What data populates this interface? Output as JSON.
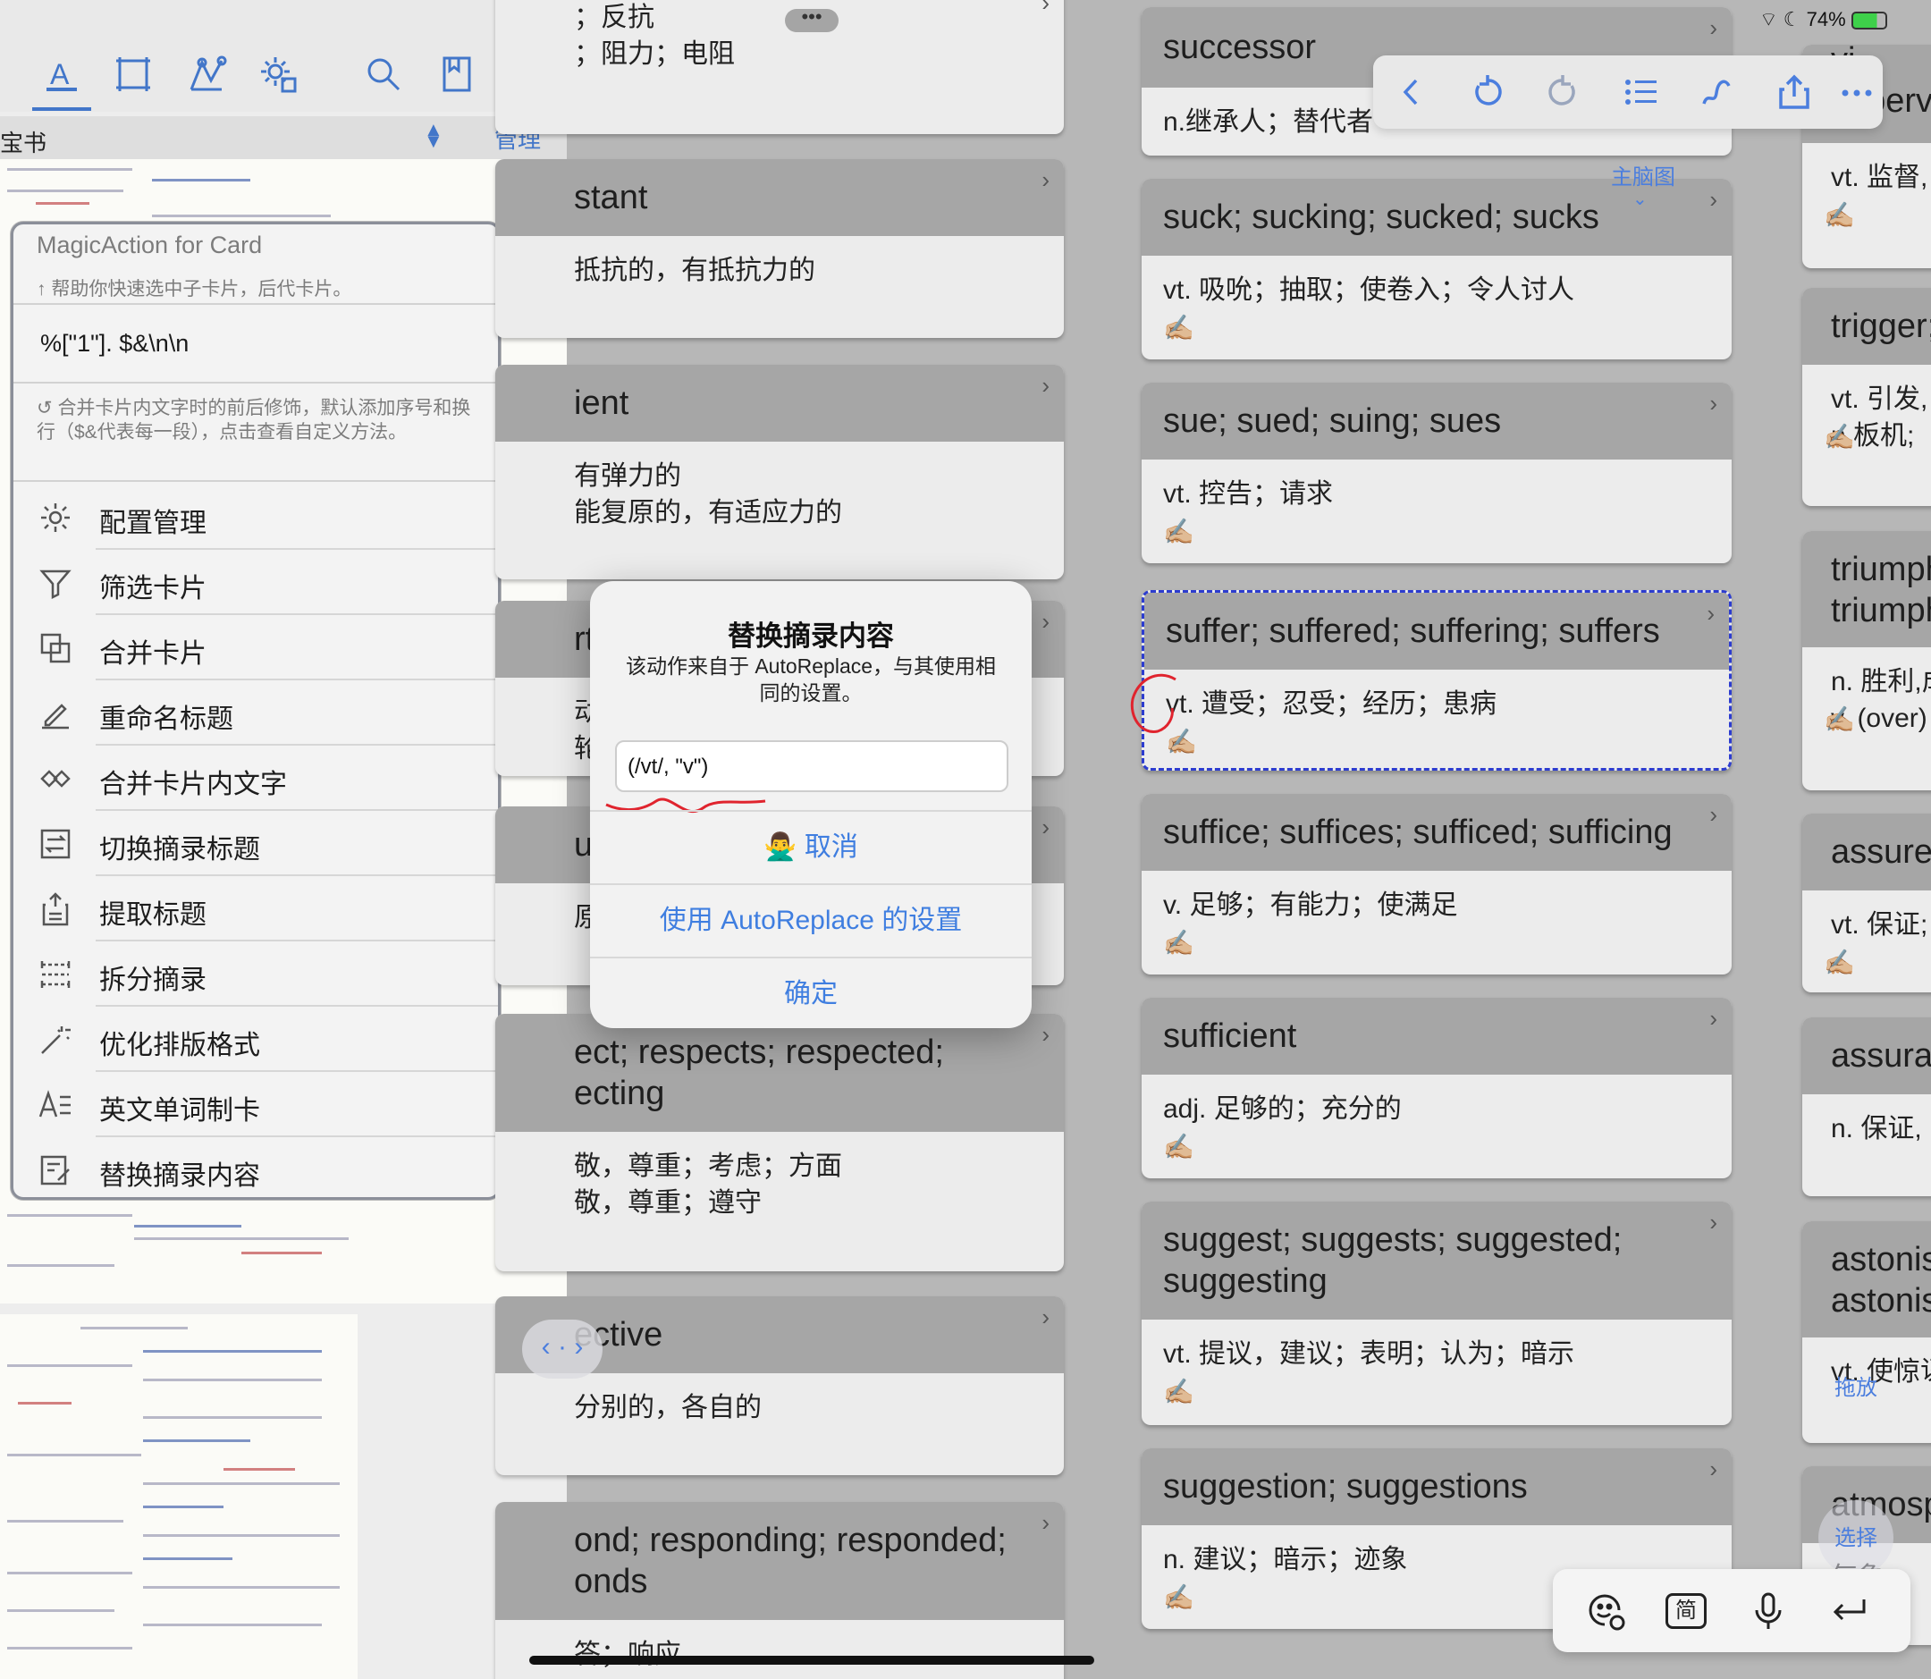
{
  "status_bar": {
    "battery": "74%"
  },
  "toolbar": {
    "icons": [
      "text-style-icon",
      "frame-icon",
      "mindmap-icon",
      "settings-gear-icon",
      "search-icon",
      "book-icon",
      "more-icon"
    ]
  },
  "pdf_tab": {
    "label": "宝书",
    "manage_label": "管理"
  },
  "magic_panel": {
    "title": "MagicAction for Card",
    "subtitle": "↑ 帮助你快速选中子卡片，后代卡片。",
    "input_value": "%[\"1\"]. $&\\n\\n",
    "hint": "合并卡片内文字时的前后修饰，默认添加序号和换行（$&代表每一段），点击查看自定义方法。",
    "items": [
      {
        "label": "配置管理",
        "icon": "gear-icon"
      },
      {
        "label": "筛选卡片",
        "icon": "filter-icon"
      },
      {
        "label": "合并卡片",
        "icon": "merge-cards-icon"
      },
      {
        "label": "重命名标题",
        "icon": "pencil-icon"
      },
      {
        "label": "合并卡片内文字",
        "icon": "merge-text-icon"
      },
      {
        "label": "切换摘录标题",
        "icon": "switch-title-icon"
      },
      {
        "label": "提取标题",
        "icon": "extract-title-icon"
      },
      {
        "label": "拆分摘录",
        "icon": "split-icon"
      },
      {
        "label": "优化排版格式",
        "icon": "magic-wand-icon"
      },
      {
        "label": "英文单词制卡",
        "icon": "english-word-icon"
      },
      {
        "label": "替换摘录内容",
        "icon": "replace-icon"
      }
    ]
  },
  "middle_cards": [
    {
      "title": "",
      "body": "；反抗\n；阻力；电阻"
    },
    {
      "title": "stant",
      "body": "抵抗的，有抵抗力的"
    },
    {
      "title": "ient",
      "body": "有弹力的\n能复原的，有适应力的"
    },
    {
      "title": "rt",
      "body": "动，\n轮；"
    },
    {
      "title": "ur",
      "body": "原，"
    },
    {
      "title": "ect; respects; respected;\necting",
      "body": "敬，尊重；考虑；方面\n敬，尊重；遵守"
    },
    {
      "title": "ective",
      "body": "分别的，各自的"
    },
    {
      "title": "ond; responding; responded;\nonds",
      "body": "答；响应"
    }
  ],
  "right_cards": [
    {
      "title": "successor",
      "body": "n.继承人；替代者"
    },
    {
      "title": "suck; sucking; sucked; sucks",
      "body": "vt. 吸吮；抽取；使卷入；令人讨人"
    },
    {
      "title": "sue; sued; suing; sues",
      "body": "vt. 控告；请求"
    },
    {
      "title": "suffer; suffered; suffering; suffers",
      "body": "vt. 遭受；忍受；经历；患病"
    },
    {
      "title": "suffice; suffices; sufficed; sufficing",
      "body": "v. 足够；有能力；使满足"
    },
    {
      "title": "sufficient",
      "body": "adj. 足够的；充分的"
    },
    {
      "title": "suggest; suggests; suggested;\nsuggesting",
      "body": "vt. 提议，建议；表明；认为；暗示"
    },
    {
      "title": "suggestion; suggestions",
      "body": "n. 建议；暗示；迹象"
    }
  ],
  "far_right_cards": [
    {
      "title": "vi\nsupervi",
      "body": "vt. 监督,"
    },
    {
      "title": "trigger;",
      "body": "vt. 引发,\nn.板机;"
    },
    {
      "title": "triumph\ntriumph",
      "body": "n. 胜利,成\nv. (over)"
    },
    {
      "title": "assure;",
      "body": "vt. 保证;"
    },
    {
      "title": "assurar",
      "body": "n. 保证,"
    },
    {
      "title": "astonis\nastonis",
      "body": "vt. 使惊讶"
    },
    {
      "title": "atmosp",
      "body": "气象;"
    }
  ],
  "pen_emoji": "✍🏼",
  "mindmap_label": "主脑图",
  "drag_label": "拖放",
  "select_label": "选择",
  "dialog": {
    "title": "替换摘录内容",
    "message": "该动作来自于 AutoReplace，与其使用相同的设置。",
    "input_value": "(/vt/, \"v\")",
    "cancel_emoji": "🙅‍♂️",
    "cancel_label": "取消",
    "use_settings_label": "使用 AutoReplace 的设置",
    "ok_label": "确定"
  },
  "keyboard_bar": {
    "simplified_label": "简"
  },
  "colors": {
    "accent": "#4276c9",
    "dialog_button": "#3f7ee0",
    "selection_border": "#2c3ccf",
    "annotation": "#e0242e"
  }
}
